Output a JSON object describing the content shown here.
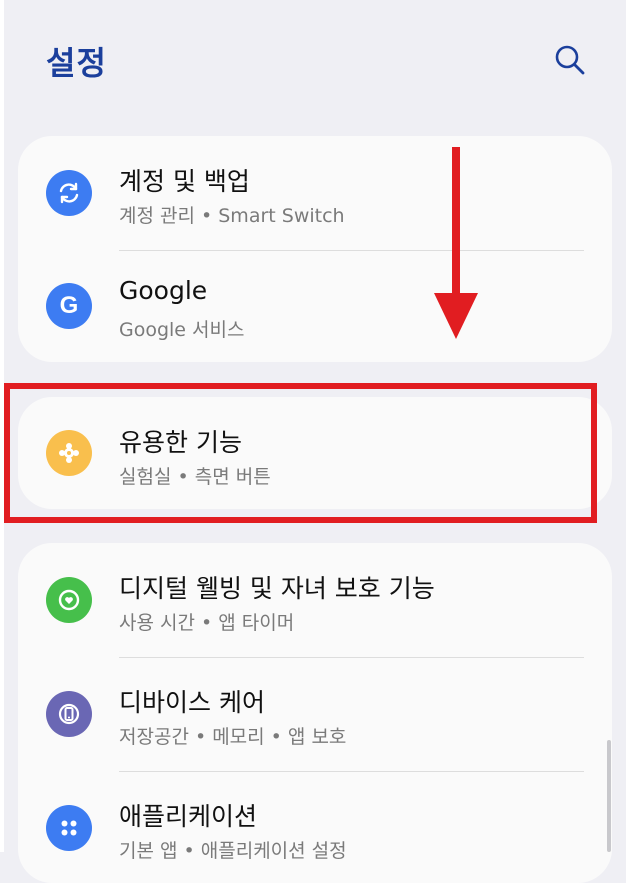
{
  "header": {
    "title": "설정",
    "search_icon": "search-icon"
  },
  "items": [
    {
      "title": "계정 및 백업",
      "subtitle": "계정 관리 • Smart Switch",
      "icon": "sync-icon",
      "color": "#3d7cf2"
    },
    {
      "title": "Google",
      "subtitle": "Google 서비스",
      "icon": "google-g-icon",
      "color": "#3d7cf2"
    },
    {
      "title": "유용한 기능",
      "subtitle": "실험실 • 측면 버튼",
      "icon": "puzzle-icon",
      "color": "#f9bf4d"
    },
    {
      "title": "디지털 웰빙 및 자녀 보호 기능",
      "subtitle": "사용 시간 • 앱 타이머",
      "icon": "wellbeing-icon",
      "color": "#46bf4b"
    },
    {
      "title": "디바이스 케어",
      "subtitle": "저장공간 • 메모리 • 앱 보호",
      "icon": "device-care-icon",
      "color": "#6a67b4"
    },
    {
      "title": "애플리케이션",
      "subtitle": "기본 앱 • 애플리케이션 설정",
      "icon": "apps-icon",
      "color": "#3d7cf2"
    }
  ],
  "annotations": {
    "highlight_color": "#e11d21",
    "arrow_direction": "down"
  }
}
